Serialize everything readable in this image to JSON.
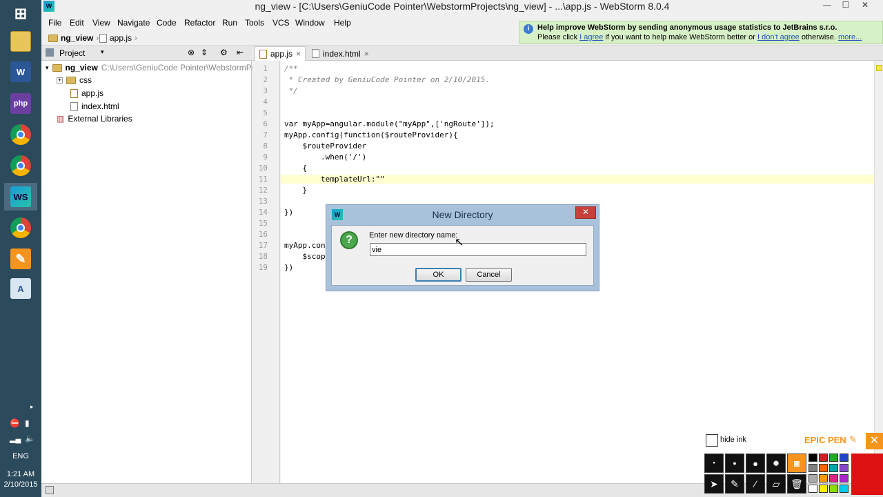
{
  "taskbar": {
    "apps": [
      {
        "name": "start",
        "label": "⊞"
      },
      {
        "name": "file-explorer",
        "label": "📁"
      },
      {
        "name": "word",
        "label": "W"
      },
      {
        "name": "phpstorm",
        "label": "php"
      },
      {
        "name": "chrome-canary",
        "label": ""
      },
      {
        "name": "chrome",
        "label": ""
      },
      {
        "name": "webstorm",
        "label": "WS"
      },
      {
        "name": "chrome-2",
        "label": ""
      },
      {
        "name": "epic-pen",
        "label": "✎"
      },
      {
        "name": "notes",
        "label": "A"
      }
    ],
    "tray": {
      "lang": "ENG",
      "time": "1:21 AM",
      "date": "2/10/2015"
    }
  },
  "window": {
    "title": "ng_view - [C:\\Users\\GeniuCode Pointer\\WebstormProjects\\ng_view] - ...\\app.js - WebStorm 8.0.4",
    "controls": [
      "—",
      "☐",
      "✕"
    ]
  },
  "menu": [
    "File",
    "Edit",
    "View",
    "Navigate",
    "Code",
    "Refactor",
    "Run",
    "Tools",
    "VCS",
    "Window",
    "Help"
  ],
  "breadcrumb": {
    "project": "ng_view",
    "file": "app.js"
  },
  "notification": {
    "title": "Help improve WebStorm by sending anonymous usage statistics to JetBrains s.r.o.",
    "line2_prefix": "Please click ",
    "agree": "I agree",
    "middle": " if you want to help make WebStorm better or ",
    "disagree": "I don't agree",
    "suffix": " otherwise. ",
    "more": "more..."
  },
  "project_panel": {
    "title": "Project",
    "root_name": "ng_view",
    "root_path": "C:\\Users\\GeniuCode Pointer\\WebstormProj",
    "items": [
      "css",
      "app.js",
      "index.html"
    ],
    "external": "External Libraries"
  },
  "editor": {
    "tabs": [
      {
        "label": "app.js",
        "active": true
      },
      {
        "label": "index.html",
        "active": false
      }
    ],
    "line_numbers": [
      "1",
      "2",
      "3",
      "4",
      "5",
      "6",
      "7",
      "8",
      "9",
      "10",
      "11",
      "12",
      "13",
      "14",
      "15",
      "16",
      "17",
      "18",
      "19"
    ],
    "lines": [
      "/**",
      " * Created by GeniuCode Pointer on 2/10/2015.",
      " */",
      "",
      "",
      "var myApp=angular.module(\"myApp\",['ngRoute']);",
      "myApp.config(function($routeProvider){",
      "    $routeProvider",
      "        .when('/')",
      "    {",
      "        templateUrl:\"\"",
      "    }",
      "",
      "})",
      "",
      "",
      "myApp.con",
      "    $scop",
      "})"
    ]
  },
  "dialog": {
    "title": "New Directory",
    "prompt": "Enter new directory name:",
    "value": "vie",
    "ok": "OK",
    "cancel": "Cancel"
  },
  "epic_pen": {
    "hide_ink": "hide ink",
    "brand": "EPIC PEN",
    "colors": [
      "#000000",
      "#cc2222",
      "#22aa22",
      "#2244cc",
      "#808080",
      "#ff6600",
      "#00aaaa",
      "#8844cc",
      "#aaaaaa",
      "#ff9900",
      "#dd2288",
      "#aa22cc",
      "#ffffff",
      "#ffee00",
      "#88dd00",
      "#00ccee"
    ],
    "active_color": "#dd1111"
  }
}
